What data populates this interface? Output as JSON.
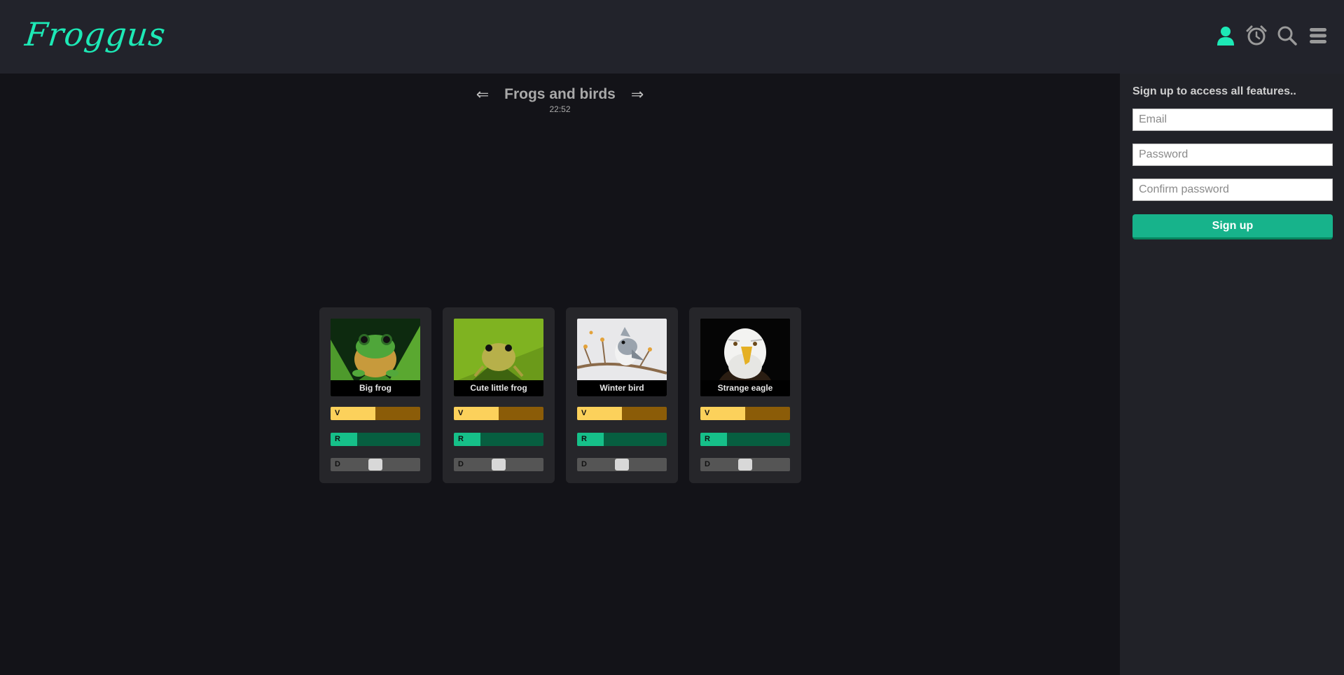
{
  "header": {
    "logo": "Froggus",
    "icons": [
      "user-icon",
      "alarm-clock-icon",
      "search-icon",
      "menu-icon"
    ],
    "accent_color": "#1de9b6"
  },
  "gallery": {
    "prev_arrow": "⇐",
    "title": "Frogs and birds",
    "next_arrow": "⇒",
    "time": "22:52"
  },
  "cards": [
    {
      "caption": "Big frog",
      "image": "green-tree-frog",
      "v_label": "V",
      "v_level": 0.5,
      "r_label": "R",
      "r_level": 0.3,
      "d_label": "D",
      "d_level": 0.5
    },
    {
      "caption": "Cute little frog",
      "image": "small-yellow-frog",
      "v_label": "V",
      "v_level": 0.5,
      "r_label": "R",
      "r_level": 0.3,
      "d_label": "D",
      "d_level": 0.5
    },
    {
      "caption": "Winter bird",
      "image": "titmouse-on-branch",
      "v_label": "V",
      "v_level": 0.5,
      "r_label": "R",
      "r_level": 0.3,
      "d_label": "D",
      "d_level": 0.5
    },
    {
      "caption": "Strange eagle",
      "image": "bald-eagle",
      "v_label": "V",
      "v_level": 0.5,
      "r_label": "R",
      "r_level": 0.3,
      "d_label": "D",
      "d_level": 0.5
    }
  ],
  "signup": {
    "heading": "Sign up to access all features..",
    "email_placeholder": "Email",
    "password_placeholder": "Password",
    "confirm_placeholder": "Confirm password",
    "button_label": "Sign up"
  }
}
